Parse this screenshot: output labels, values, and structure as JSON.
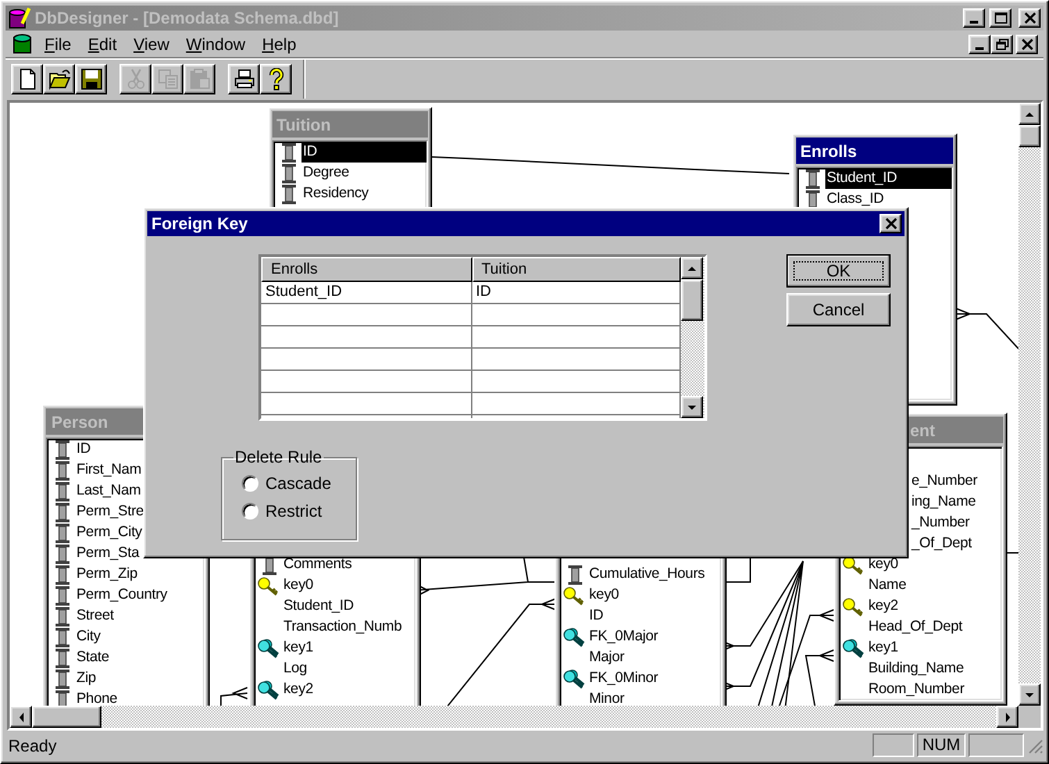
{
  "window": {
    "title": "DbDesigner - [Demodata Schema.dbd]",
    "active": false
  },
  "menu": [
    "File",
    "Edit",
    "View",
    "Window",
    "Help"
  ],
  "toolbar": [
    {
      "kind": "new",
      "disabled": false
    },
    {
      "kind": "open",
      "disabled": false
    },
    {
      "kind": "save",
      "disabled": false
    },
    {
      "kind": "cut",
      "disabled": true
    },
    {
      "kind": "copy",
      "disabled": true
    },
    {
      "kind": "paste",
      "disabled": true
    },
    {
      "kind": "print",
      "disabled": false
    },
    {
      "kind": "help",
      "disabled": false
    }
  ],
  "canvas": {
    "entities": [
      {
        "title": "Tuition",
        "active": false,
        "rows": [
          {
            "kind": "column",
            "name": "ID",
            "selected": true
          },
          {
            "kind": "column",
            "name": "Degree",
            "selected": false
          },
          {
            "kind": "column",
            "name": "Residency",
            "selected": false
          }
        ]
      },
      {
        "title": "Enrolls",
        "active": true,
        "rows": [
          {
            "kind": "column",
            "name": "Student_ID",
            "selected": true
          },
          {
            "kind": "column",
            "name": "Class_ID",
            "selected": false
          }
        ]
      },
      {
        "title": "Person",
        "active": false,
        "rows": [
          {
            "kind": "column",
            "name": "ID",
            "selected": false
          },
          {
            "kind": "column",
            "name": "First_Nam",
            "selected": false
          },
          {
            "kind": "column",
            "name": "Last_Nam",
            "selected": false
          },
          {
            "kind": "column",
            "name": "Perm_Stre",
            "selected": false
          },
          {
            "kind": "column",
            "name": "Perm_City",
            "selected": false
          },
          {
            "kind": "column",
            "name": "Perm_Sta",
            "selected": false
          },
          {
            "kind": "column",
            "name": "Perm_Zip",
            "selected": false
          },
          {
            "kind": "column",
            "name": "Perm_Country",
            "selected": false
          },
          {
            "kind": "column",
            "name": "Street",
            "selected": false
          },
          {
            "kind": "column",
            "name": "City",
            "selected": false
          },
          {
            "kind": "column",
            "name": "State",
            "selected": false
          },
          {
            "kind": "column",
            "name": "Zip",
            "selected": false
          },
          {
            "kind": "column",
            "name": "Phone",
            "selected": false
          }
        ]
      },
      {
        "rows": [
          {
            "kind": "column",
            "name": "Comments",
            "selected": false
          },
          {
            "kind": "primary_key",
            "name": "key0",
            "selected": false
          },
          {
            "kind": "key_field",
            "name": "Student_ID",
            "selected": false
          },
          {
            "kind": "key_field",
            "name": "Transaction_Numb",
            "selected": false
          },
          {
            "kind": "foreign_key",
            "name": "key1",
            "selected": false
          },
          {
            "kind": "key_field",
            "name": "Log",
            "selected": false
          },
          {
            "kind": "foreign_key",
            "name": "key2",
            "selected": false
          }
        ]
      },
      {
        "rows": [
          {
            "kind": "column",
            "name": "Cumulative_Hours",
            "selected": false
          },
          {
            "kind": "primary_key",
            "name": "key0",
            "selected": false
          },
          {
            "kind": "key_field",
            "name": "ID",
            "selected": false
          },
          {
            "kind": "foreign_key",
            "name": "FK_0Major",
            "selected": false
          },
          {
            "kind": "key_field",
            "name": "Major",
            "selected": false
          },
          {
            "kind": "foreign_key",
            "name": "FK_0Minor",
            "selected": false
          },
          {
            "kind": "key_field",
            "name": "Minor",
            "selected": false
          }
        ]
      },
      {
        "title": "ent",
        "active": false,
        "rows": [
          {
            "kind": "key_field",
            "name": "e_Number",
            "selected": false
          },
          {
            "kind": "key_field",
            "name": "ing_Name",
            "selected": false
          },
          {
            "kind": "key_field",
            "name": "_Number",
            "selected": false
          },
          {
            "kind": "key_field",
            "name": "_Of_Dept",
            "selected": false
          },
          {
            "kind": "primary_key",
            "name": "key0",
            "selected": false
          },
          {
            "kind": "key_field",
            "name": "Name",
            "selected": false
          },
          {
            "kind": "primary_key",
            "name": "key2",
            "selected": false
          },
          {
            "kind": "key_field",
            "name": "Head_Of_Dept",
            "selected": false
          },
          {
            "kind": "foreign_key",
            "name": "key1",
            "selected": false
          },
          {
            "kind": "key_field",
            "name": "Building_Name",
            "selected": false
          },
          {
            "kind": "key_field",
            "name": "Room_Number",
            "selected": false
          }
        ]
      }
    ]
  },
  "dialog": {
    "title": "Foreign Key",
    "grid": {
      "columns": [
        "Enrolls",
        "Tuition"
      ],
      "rows": [
        [
          "Student_ID",
          "ID"
        ]
      ]
    },
    "buttons": [
      {
        "label": "OK",
        "default": true
      },
      {
        "label": "Cancel",
        "default": false
      }
    ],
    "delete_rule": {
      "label": "Delete Rule",
      "options": [
        {
          "label": "Cascade",
          "selected": false
        },
        {
          "label": "Restrict",
          "selected": false
        }
      ]
    }
  },
  "status_bar": {
    "text": "Ready",
    "panels": [
      "NUM"
    ]
  }
}
